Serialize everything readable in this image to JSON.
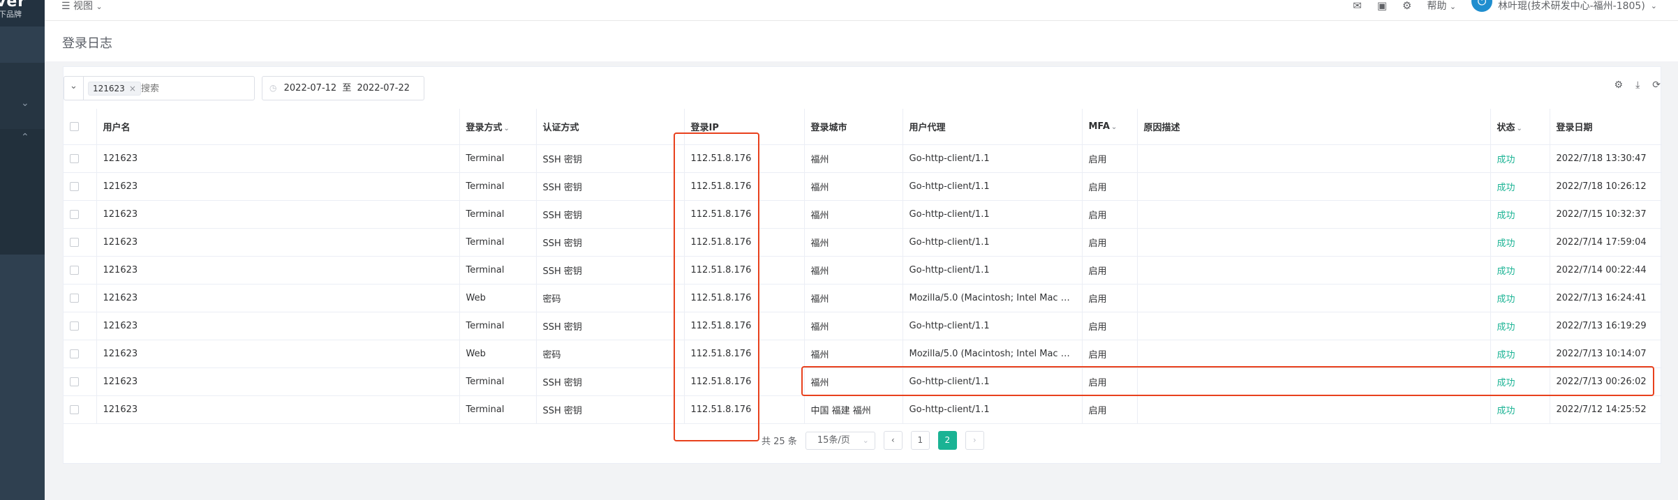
{
  "sidebar": {
    "logo_text": "ver",
    "logo_sub": "下品牌"
  },
  "topbar": {
    "view_label": "视图",
    "help_label": "帮助",
    "user_label": "林叶琨(技术研发中心-福州-1805)"
  },
  "page": {
    "title": "登录日志"
  },
  "filter": {
    "tag": "121623",
    "placeholder": "搜索"
  },
  "date_range": {
    "start": "2022-07-12",
    "sep": "至",
    "end": "2022-07-22"
  },
  "table": {
    "headers": [
      "用户名",
      "登录方式",
      "认证方式",
      "登录IP",
      "登录城市",
      "用户代理",
      "MFA",
      "原因描述",
      "状态",
      "登录日期"
    ],
    "rows": [
      [
        "121623",
        "Terminal",
        "SSH 密钥",
        "112.51.8.176",
        "福州",
        "Go-http-client/1.1",
        "启用",
        "",
        "成功",
        "2022/7/18 13:30:47"
      ],
      [
        "121623",
        "Terminal",
        "SSH 密钥",
        "112.51.8.176",
        "福州",
        "Go-http-client/1.1",
        "启用",
        "",
        "成功",
        "2022/7/18 10:26:12"
      ],
      [
        "121623",
        "Terminal",
        "SSH 密钥",
        "112.51.8.176",
        "福州",
        "Go-http-client/1.1",
        "启用",
        "",
        "成功",
        "2022/7/15 10:32:37"
      ],
      [
        "121623",
        "Terminal",
        "SSH 密钥",
        "112.51.8.176",
        "福州",
        "Go-http-client/1.1",
        "启用",
        "",
        "成功",
        "2022/7/14 17:59:04"
      ],
      [
        "121623",
        "Terminal",
        "SSH 密钥",
        "112.51.8.176",
        "福州",
        "Go-http-client/1.1",
        "启用",
        "",
        "成功",
        "2022/7/14 00:22:44"
      ],
      [
        "121623",
        "Web",
        "密码",
        "112.51.8.176",
        "福州",
        "Mozilla/5.0 (Macintosh; Intel Mac OS ...",
        "启用",
        "",
        "成功",
        "2022/7/13 16:24:41"
      ],
      [
        "121623",
        "Terminal",
        "SSH 密钥",
        "112.51.8.176",
        "福州",
        "Go-http-client/1.1",
        "启用",
        "",
        "成功",
        "2022/7/13 16:19:29"
      ],
      [
        "121623",
        "Web",
        "密码",
        "112.51.8.176",
        "福州",
        "Mozilla/5.0 (Macintosh; Intel Mac OS ...",
        "启用",
        "",
        "成功",
        "2022/7/13 10:14:07"
      ],
      [
        "121623",
        "Terminal",
        "SSH 密钥",
        "112.51.8.176",
        "福州",
        "Go-http-client/1.1",
        "启用",
        "",
        "成功",
        "2022/7/13 00:26:02"
      ],
      [
        "121623",
        "Terminal",
        "SSH 密钥",
        "112.51.8.176",
        "中国 福建 福州",
        "Go-http-client/1.1",
        "启用",
        "",
        "成功",
        "2022/7/12 14:25:52"
      ]
    ]
  },
  "pager": {
    "total": "共 25 条",
    "page_size": "15条/页",
    "pages": [
      "1",
      "2"
    ],
    "current": "2"
  },
  "colors": {
    "accent": "#1ab394",
    "annotation": "#e8401c",
    "sidebar": "#2f4050"
  }
}
